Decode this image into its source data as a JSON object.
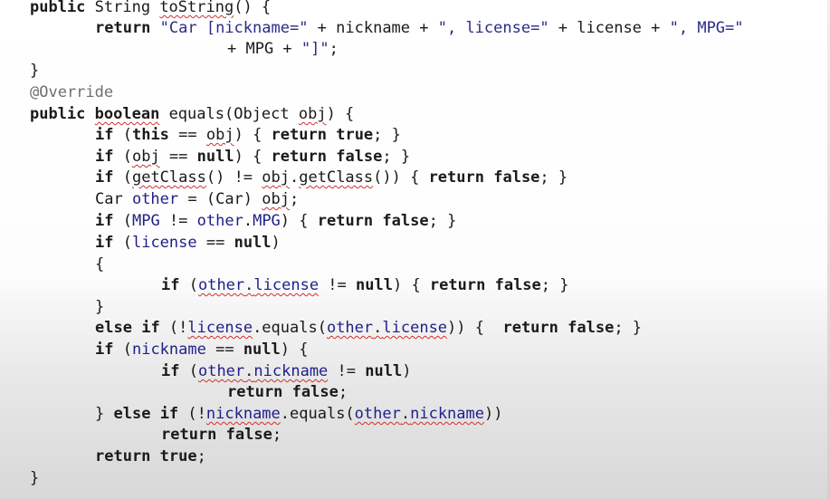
{
  "code": {
    "l1": {
      "kw_public": "public",
      "t_string": " String ",
      "m_tostring": "toString",
      "t_paren": "() {"
    },
    "l2": {
      "kw_return": "return",
      "s1": "\"Car [nickname=\"",
      "t1": " + nickname + ",
      "s2": "\", license=\"",
      "t2": " + license + ",
      "s3": "\", MPG=\""
    },
    "l3": {
      "t1": "+ MPG + ",
      "s1": "\"]\"",
      "t2": ";"
    },
    "l4": {
      "t": "}"
    },
    "l5": {
      "ann": "@Override"
    },
    "l6": {
      "kw_public": "public",
      "sp": " ",
      "kw_boolean": "boolean",
      "t1": " equals(Object ",
      "p_obj": "obj",
      "t2": ") {"
    },
    "l7": {
      "kw_if": "if",
      "t1": " (",
      "kw_this": "this",
      "t2": " == ",
      "v_obj": "obj",
      "t3": ") { ",
      "kw_return": "return",
      "sp": " ",
      "kw_true": "true",
      "t4": "; }"
    },
    "l8": {
      "kw_if": "if",
      "t1": " (",
      "v_obj": "obj",
      "t2": " == ",
      "kw_null": "null",
      "t3": ") { ",
      "kw_return": "return",
      "sp": " ",
      "kw_false": "false",
      "t4": "; }"
    },
    "l9": {
      "kw_if": "if",
      "t1": " (",
      "m_getclass": "getClass",
      "t2": "() != ",
      "v_obj": "obj",
      "t3": ".",
      "m_getclass2": "getClass",
      "t4": "()) { ",
      "kw_return": "return",
      "sp": " ",
      "kw_false": "false",
      "t5": "; }"
    },
    "l10": {
      "t1": "Car ",
      "v_other": "other",
      "t2": " = (Car) ",
      "v_obj": "obj",
      "t3": ";"
    },
    "l11": {
      "kw_if": "if",
      "t1": " (",
      "f_mpg": "MPG",
      "t2": " != ",
      "v_other": "other",
      "t3": ".",
      "f_mpg2": "MPG",
      "t4": ") { ",
      "kw_return": "return",
      "sp": " ",
      "kw_false": "false",
      "t5": "; }"
    },
    "l12": {
      "kw_if": "if",
      "t1": " (",
      "f_license": "license",
      "t2": " == ",
      "kw_null": "null",
      "t3": ")"
    },
    "l13": {
      "t": "{"
    },
    "l14": {
      "kw_if": "if",
      "t1": " (",
      "v_other": "other",
      "t2": ".",
      "f_license": "license",
      "t3": " != ",
      "kw_null": "null",
      "t4": ") { ",
      "kw_return": "return",
      "sp": " ",
      "kw_false": "false",
      "t5": "; }"
    },
    "l15": {
      "t": "}"
    },
    "l16": {
      "kw_else": "else",
      "sp": " ",
      "kw_if": "if",
      "t1": " (!",
      "f_license": "license",
      "t2": ".equals(",
      "v_other": "other",
      "t3": ".",
      "f_license2": "license",
      "t4": ")) {  ",
      "kw_return": "return",
      "sp2": " ",
      "kw_false": "false",
      "t5": "; }"
    },
    "l17": {
      "kw_if": "if",
      "t1": " (",
      "f_nickname": "nickname",
      "t2": " == ",
      "kw_null": "null",
      "t3": ") {"
    },
    "l18": {
      "kw_if": "if",
      "t1": " (",
      "v_other": "other",
      "t2": ".",
      "f_nickname": "nickname",
      "t3": " != ",
      "kw_null": "null",
      "t4": ")"
    },
    "l19": {
      "kw_return": "return",
      "sp": " ",
      "kw_false": "false",
      "t1": ";"
    },
    "l20": {
      "t1": "} ",
      "kw_else": "else",
      "sp": " ",
      "kw_if": "if",
      "t2": " (!",
      "f_nickname": "nickname",
      "t3": ".equals(",
      "v_other": "other",
      "t4": ".",
      "f_nickname2": "nickname",
      "t5": "))"
    },
    "l21": {
      "kw_return": "return",
      "sp": " ",
      "kw_false": "false",
      "t1": ";"
    },
    "l22": {
      "kw_return": "return",
      "sp": " ",
      "kw_true": "true",
      "t1": ";"
    },
    "l23": {
      "t": "}"
    }
  }
}
